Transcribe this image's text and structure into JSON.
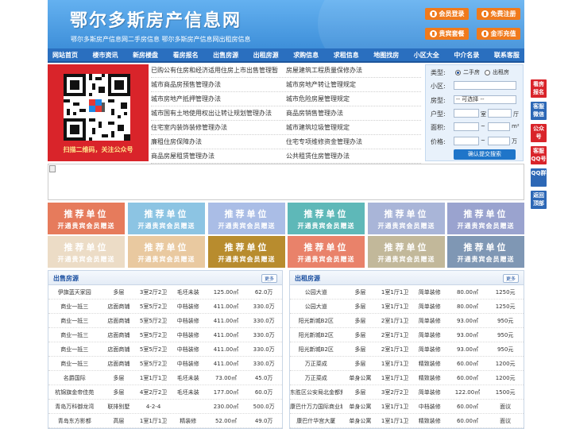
{
  "header": {
    "logo": "鄂尔多斯房产信息网",
    "slogan": "鄂尔多斯房产信息网二手房信息   鄂尔多斯房产信息网出租房信息",
    "buttons": [
      "会员登录",
      "免费注册",
      "贵宾套餐",
      "金币充值"
    ]
  },
  "nav": [
    "网站首页",
    "楼市资讯",
    "新房楼盘",
    "看房报名",
    "出售房源",
    "出租房源",
    "求购信息",
    "求租信息",
    "地图找房",
    "小区大全",
    "中介名录",
    "联系客服"
  ],
  "qr": {
    "caption": "扫描二维码，关注公众号"
  },
  "links": [
    [
      "已购公有住房和经济适用住房上市出售管理暂",
      "房屋建筑工程质量保修办法"
    ],
    [
      "城市商品房预售管理办法",
      "城市房地产转让管理规定"
    ],
    [
      "城市房地产抵押管理办法",
      "城市危险房屋管理规定"
    ],
    [
      "城市国有土地使用权出让转让规划管理办法",
      "商品房销售管理办法"
    ],
    [
      "住宅室内装饰装修管理办法",
      "城市建筑垃圾管理规定"
    ],
    [
      "廉租住房保障办法",
      "住宅专项维修资金管理办法"
    ],
    [
      "商品房屋租赁管理办法",
      "公共租赁住房管理办法"
    ]
  ],
  "search": {
    "type_label": "类型:",
    "type_options": [
      "二手房",
      "出租房"
    ],
    "community_label": "小区:",
    "community_value": "",
    "house_type_label": "房型:",
    "house_type_value": "-- 可选择 --",
    "layout_label": "户型:",
    "room_unit": "室",
    "hall_unit": "厅",
    "area_label": "面积:",
    "area_sep": "~",
    "area_unit": "m²",
    "price_label": "价格:",
    "price_sep": "~",
    "price_unit": "万",
    "submit_label": "确认提交搜索"
  },
  "recommend": {
    "title": "推荐单位",
    "subtitle": "开通贵宾会员赠送",
    "colors": [
      "#e67b5c",
      "#8cc4e3",
      "#aabde6",
      "#5eb8b8",
      "#a9b5d8",
      "#9aa3cf",
      "#ecdcc6",
      "#e9c9a0",
      "#b88c2e",
      "#e9826a",
      "#c2b89a",
      "#7f97b4"
    ]
  },
  "sale": {
    "title": "出售房源",
    "more": "更多",
    "rows": [
      [
        "伊旗蓝天家园",
        "多层",
        "3室2厅2卫",
        "毛坯未装",
        "125.00㎡",
        "62.0万"
      ],
      [
        "商业一抵三",
        "店面商铺",
        "5室5厅2卫",
        "中档装修",
        "411.00㎡",
        "330.0万"
      ],
      [
        "商业一抵三",
        "店面商铺",
        "5室5厅2卫",
        "中档装修",
        "411.00㎡",
        "330.0万"
      ],
      [
        "商业一抵三",
        "店面商铺",
        "5室5厅2卫",
        "中档装修",
        "411.00㎡",
        "330.0万"
      ],
      [
        "商业一抵三",
        "店面商铺",
        "5室5厅2卫",
        "中档装修",
        "411.00㎡",
        "330.0万"
      ],
      [
        "商业一抵三",
        "店面商铺",
        "5室5厅2卫",
        "中档装修",
        "411.00㎡",
        "330.0万"
      ],
      [
        "名爵国际",
        "多层",
        "1室1厅1卫",
        "毛坯未装",
        "73.00㎡",
        "45.0万"
      ],
      [
        "杭锦旗金帝佳苑",
        "多层",
        "4室2厅2卫",
        "毛坯未装",
        "177.00㎡",
        "60.0万"
      ],
      [
        "青岛万科御龙湾",
        "联排别墅",
        "4-2-4",
        "",
        "230.00㎡",
        "500.0万"
      ],
      [
        "青岛东方影都",
        "高层",
        "1室1厅1卫",
        "精装修",
        "52.00㎡",
        "49.0万"
      ]
    ]
  },
  "rent": {
    "title": "出租房源",
    "more": "更多",
    "rows": [
      [
        "公园大道",
        "多层",
        "1室1厅1卫",
        "简单装修",
        "80.00㎡",
        "1250元"
      ],
      [
        "公园大道",
        "多层",
        "1室1厅1卫",
        "简单装修",
        "80.00㎡",
        "1250元"
      ],
      [
        "阳光新城B2区",
        "多层",
        "2室1厅1卫",
        "简单装修",
        "93.00㎡",
        "950元"
      ],
      [
        "阳光新城B2区",
        "多层",
        "2室1厅1卫",
        "简单装修",
        "93.00㎡",
        "950元"
      ],
      [
        "阳光新城B2区",
        "多层",
        "2室1厅1卫",
        "简单装修",
        "93.00㎡",
        "950元"
      ],
      [
        "万正菜成",
        "多层",
        "1室1厅1卫",
        "精致装修",
        "60.00㎡",
        "1200元"
      ],
      [
        "万正菜成",
        "单身公寓",
        "1室1厅1卫",
        "精致装修",
        "60.00㎡",
        "1200元"
      ],
      [
        "东胜区公安局北金都紫",
        "多层",
        "3室2厅2卫",
        "简单装修",
        "122.00㎡",
        "1500元"
      ],
      [
        "康巴什万力国际商业城",
        "单身公寓",
        "1室1厅1卫",
        "中档装修",
        "60.00㎡",
        "面议"
      ],
      [
        "康巴什华宫大厦",
        "单身公寓",
        "1室1厅1卫",
        "精致装修",
        "60.00㎡",
        "面议"
      ]
    ]
  },
  "floats": [
    "看房报名",
    "客服微信",
    "公众号",
    "客服QQ号",
    "QQ群",
    "返回顶部"
  ]
}
